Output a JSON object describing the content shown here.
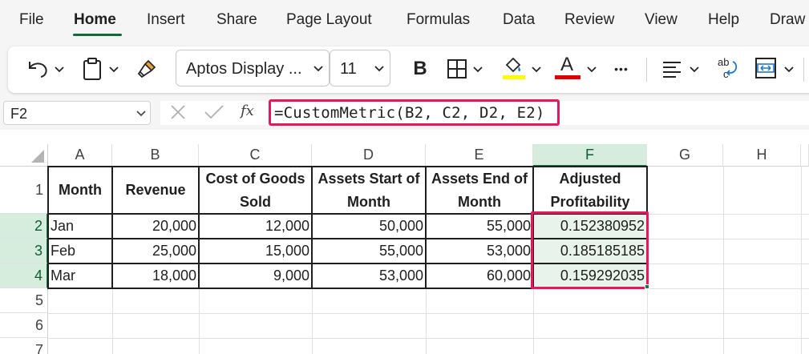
{
  "menu": {
    "tabs": [
      "File",
      "Home",
      "Insert",
      "Share",
      "Page Layout",
      "Formulas",
      "Data",
      "Review",
      "View",
      "Help",
      "Draw"
    ],
    "active": "Home"
  },
  "ribbon": {
    "font_name": "Aptos Display ...",
    "font_size": "11",
    "bold_label": "B",
    "font_color_label": "A",
    "more_label": "•••",
    "fill_color": "#ffff00",
    "font_color": "#e00000",
    "icons": [
      "undo-icon",
      "paste-icon",
      "format-painter-icon",
      "borders-icon",
      "fill-color-icon",
      "font-color-icon",
      "align-icon",
      "wrap-text-icon",
      "merge-icon"
    ]
  },
  "formula_bar": {
    "name_box": "F2",
    "fx_label": "fx",
    "formula": "=CustomMetric(B2, C2, D2, E2)"
  },
  "sheet": {
    "columns": [
      "A",
      "B",
      "C",
      "D",
      "E",
      "F",
      "G",
      "H"
    ],
    "rows": [
      "1",
      "2",
      "3",
      "4",
      "5",
      "6",
      "7"
    ],
    "selected_column": "F",
    "header_row": {
      "A": "Month",
      "B": "Revenue",
      "C1": "Cost of Goods",
      "C2": "Sold",
      "D1": "Assets Start of",
      "D2": "Month",
      "E1": "Assets End of",
      "E2": "Month",
      "F1": "Adjusted",
      "F2": "Profitability"
    },
    "data": [
      [
        "Jan",
        "20,000",
        "12,000",
        "50,000",
        "55,000",
        "0.152380952"
      ],
      [
        "Feb",
        "25,000",
        "15,000",
        "55,000",
        "53,000",
        "0.185185185"
      ],
      [
        "Mar",
        "18,000",
        "9,000",
        "53,000",
        "60,000",
        "0.159292035"
      ]
    ],
    "accent_color": "#107c41",
    "highlight_color": "#e8175d"
  }
}
